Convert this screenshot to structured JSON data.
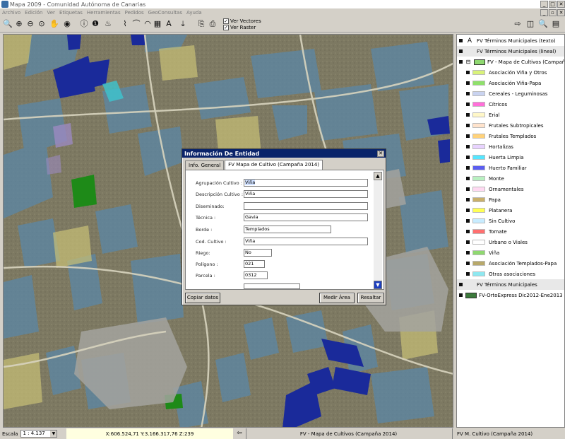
{
  "window": {
    "title": "Mapa  2009  - Comunidad Autónoma de Canarias"
  },
  "menu": [
    "Archivo",
    "Edición",
    "Ver",
    "Etiquetas",
    "Herramientas",
    "Pedidos",
    "GeoConsultas",
    "Ayuda"
  ],
  "toolbar": {
    "ver_vectores": "Ver Vectores",
    "ver_raster": "Ver Raster"
  },
  "legend": {
    "layers": [
      {
        "label": "FV Términos Municipales (texto)",
        "glyph": "A"
      },
      {
        "label": "FV Términos Municipales (lineal)"
      },
      {
        "label": "FV - Mapa de Cultivos (Campaña 2014)"
      }
    ],
    "items": [
      {
        "label": "Asociación Viña y Otros",
        "color": "#d9f27a"
      },
      {
        "label": "Asociación Viña-Papa",
        "color": "#8fe06b"
      },
      {
        "label": "Cereales - Leguminosas",
        "color": "#c9d3f0"
      },
      {
        "label": "Cítricos",
        "color": "#ff6fd9"
      },
      {
        "label": "Erial",
        "color": "#fff7c8"
      },
      {
        "label": "Frutales Subtropicales",
        "color": "#ffe3cc"
      },
      {
        "label": "Frutales Templados",
        "color": "#ffd27a"
      },
      {
        "label": "Hortalizas",
        "color": "#e8d3ff"
      },
      {
        "label": "Huerta Limpia",
        "color": "#55e6ff"
      },
      {
        "label": "Huerto Familiar",
        "color": "#5b5ef0"
      },
      {
        "label": "Monte",
        "color": "#b8f0c0"
      },
      {
        "label": "Ornamentales",
        "color": "#ffd9f2"
      },
      {
        "label": "Papa",
        "color": "#c9b06b"
      },
      {
        "label": "Platanera",
        "color": "#ffff55"
      },
      {
        "label": "Sin Cultivo",
        "color": "#c8ecff"
      },
      {
        "label": "Tomate",
        "color": "#ff7070"
      },
      {
        "label": "Urbano o Viales",
        "color": "#ffffff"
      },
      {
        "label": "Viña",
        "color": "#8fd870"
      },
      {
        "label": "Asociación Templados-Papa",
        "color": "#b8a96b"
      },
      {
        "label": "Otras asociaciones",
        "color": "#8ee8f0"
      }
    ],
    "bottom_layers": [
      {
        "label": "FV Términos Municipales"
      },
      {
        "label": "FV-OrtoExpress Dic2012-Ene2013 (25cm/pixel)"
      }
    ]
  },
  "dialog": {
    "title": "Información De Entidad",
    "close": "✕",
    "tabs": [
      "Info. General",
      "FV Mapa de Cultivo (Campaña 2014)"
    ],
    "fields": [
      {
        "label": "Agrupación Cultivo :",
        "value": "Viña"
      },
      {
        "label": "Descripción Cultivo :",
        "value": "Viña"
      },
      {
        "label": "Diseminado:",
        "value": ""
      },
      {
        "label": "Técnica :",
        "value": "Gavia"
      },
      {
        "label": "Borde :",
        "value": "Templados"
      },
      {
        "label": "Cod. Cultivo :",
        "value": "Viña"
      },
      {
        "label": "Riego:",
        "value": "No"
      },
      {
        "label": "Polígono :",
        "value": "021"
      },
      {
        "label": "Parcela :",
        "value": "0312"
      },
      {
        "label": "",
        "value": ""
      }
    ],
    "buttons": {
      "copiar": "Copiar datos",
      "medir": "Medir Área",
      "resaltar": "Resaltar"
    }
  },
  "status": {
    "scale_label": "Escala",
    "scale_value": "1 : 4.137",
    "coords": "X:606.524,71  Y:3.166.317,76  Z:239",
    "active_layer": "FV - Mapa de Cultivos (Campaña 2014)",
    "field": "FV M. Cultivo (Campaña 2014)"
  }
}
